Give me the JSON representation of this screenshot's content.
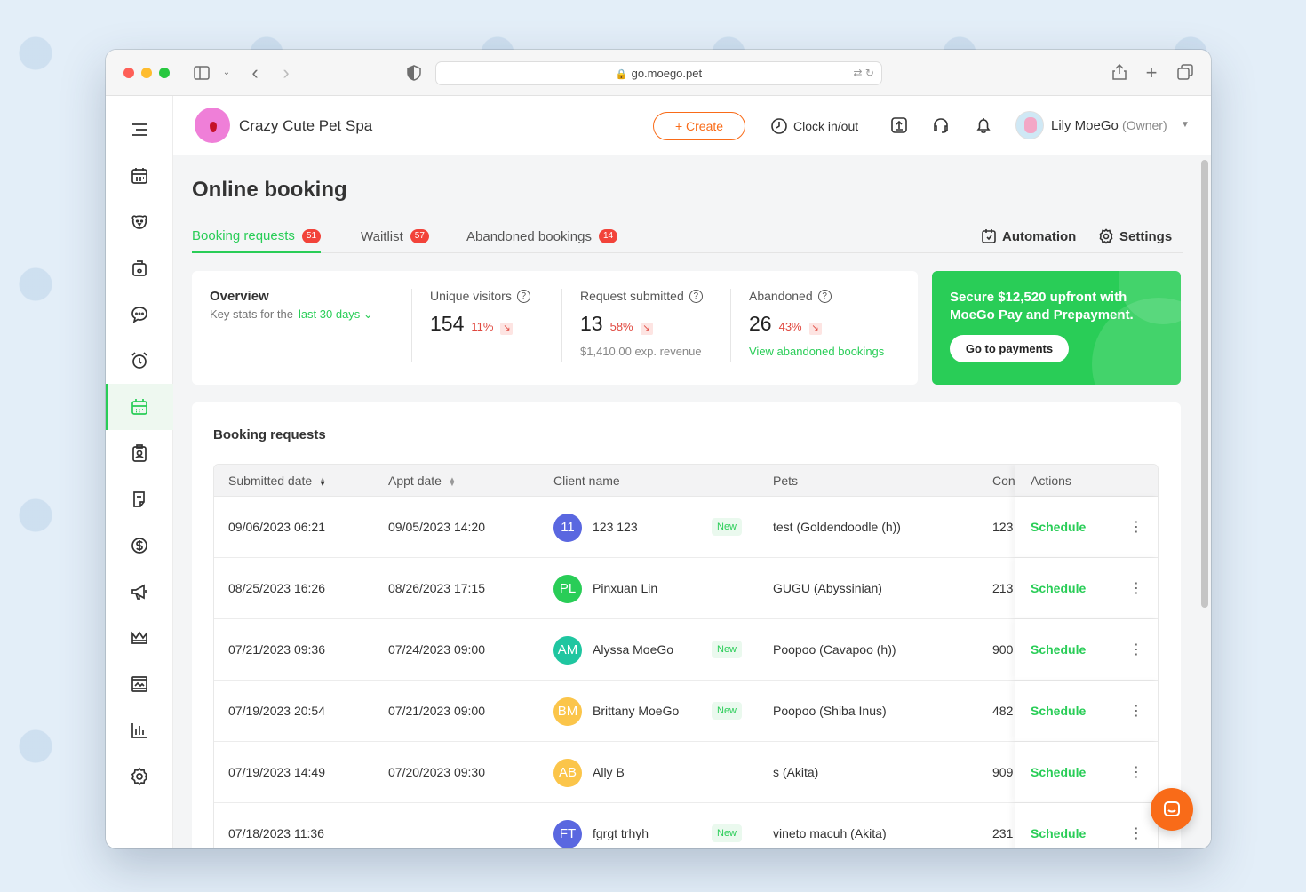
{
  "browser": {
    "url": "go.moego.pet"
  },
  "header": {
    "business_name": "Crazy Cute Pet Spa",
    "create_label": "+ Create",
    "clock_label": "Clock in/out",
    "user_name": "Lily MoeGo",
    "user_role": "(Owner)"
  },
  "page": {
    "title": "Online booking",
    "tabs": [
      {
        "label": "Booking requests",
        "count": "51"
      },
      {
        "label": "Waitlist",
        "count": "57"
      },
      {
        "label": "Abandoned bookings",
        "count": "14"
      }
    ],
    "automation_label": "Automation",
    "settings_label": "Settings"
  },
  "overview": {
    "title": "Overview",
    "subtitle": "Key stats for the",
    "range": "last 30 days",
    "stats": [
      {
        "label": "Unique visitors",
        "value": "154",
        "pct": "11%"
      },
      {
        "label": "Request submitted",
        "value": "13",
        "pct": "58%",
        "extra": "$1,410.00 exp. revenue"
      },
      {
        "label": "Abandoned",
        "value": "26",
        "pct": "43%",
        "link": "View abandoned bookings"
      }
    ]
  },
  "promo": {
    "text": "Secure $12,520 upfront with MoeGo Pay and Prepayment.",
    "button": "Go to payments"
  },
  "list": {
    "title": "Booking requests",
    "columns": [
      "Submitted date",
      "Appt date",
      "Client name",
      "Pets",
      "Con",
      "Actions"
    ],
    "action_label": "Schedule",
    "new_label": "New",
    "rows": [
      {
        "submitted": "09/06/2023 06:21",
        "appt": "09/05/2023 14:20",
        "initials": "11",
        "color": "#5a67e0",
        "client": "123 123",
        "is_new": true,
        "pets": "test (Goldendoodle (h))",
        "con": "123"
      },
      {
        "submitted": "08/25/2023 16:26",
        "appt": "08/26/2023 17:15",
        "initials": "PL",
        "color": "#29cd57",
        "client": "Pinxuan Lin",
        "is_new": false,
        "pets": "GUGU (Abyssinian)",
        "con": "213"
      },
      {
        "submitted": "07/21/2023 09:36",
        "appt": "07/24/2023 09:00",
        "initials": "AM",
        "color": "#1fc6a0",
        "client": "Alyssa MoeGo",
        "is_new": true,
        "pets": "Poopoo (Cavapoo (h))",
        "con": "900"
      },
      {
        "submitted": "07/19/2023 20:54",
        "appt": "07/21/2023 09:00",
        "initials": "BM",
        "color": "#fbc54a",
        "client": "Brittany MoeGo",
        "is_new": true,
        "pets": "Poopoo (Shiba Inus)",
        "con": "482"
      },
      {
        "submitted": "07/19/2023 14:49",
        "appt": "07/20/2023 09:30",
        "initials": "AB",
        "color": "#fbc54a",
        "client": "Ally B",
        "is_new": false,
        "pets": "s (Akita)",
        "con": "909"
      },
      {
        "submitted": "07/18/2023 11:36",
        "appt": "",
        "initials": "FT",
        "color": "#5a67e0",
        "client": "fgrgt trhyh",
        "is_new": true,
        "pets": "vineto macuh (Akita)",
        "con": "231"
      }
    ]
  },
  "sidebar": {
    "items": [
      "menu-icon",
      "calendar-icon",
      "pet-icon",
      "grooming-icon",
      "chat-icon",
      "alarm-icon",
      "online-booking-icon",
      "client-card-icon",
      "agreement-icon",
      "dollar-icon",
      "megaphone-icon",
      "crown-icon",
      "photo-icon",
      "reports-icon",
      "settings-icon"
    ],
    "active": "online-booking-icon"
  },
  "colors": {
    "brand_green": "#29cd57",
    "accent_orange": "#f96b18",
    "badge_red": "#f2433a"
  }
}
